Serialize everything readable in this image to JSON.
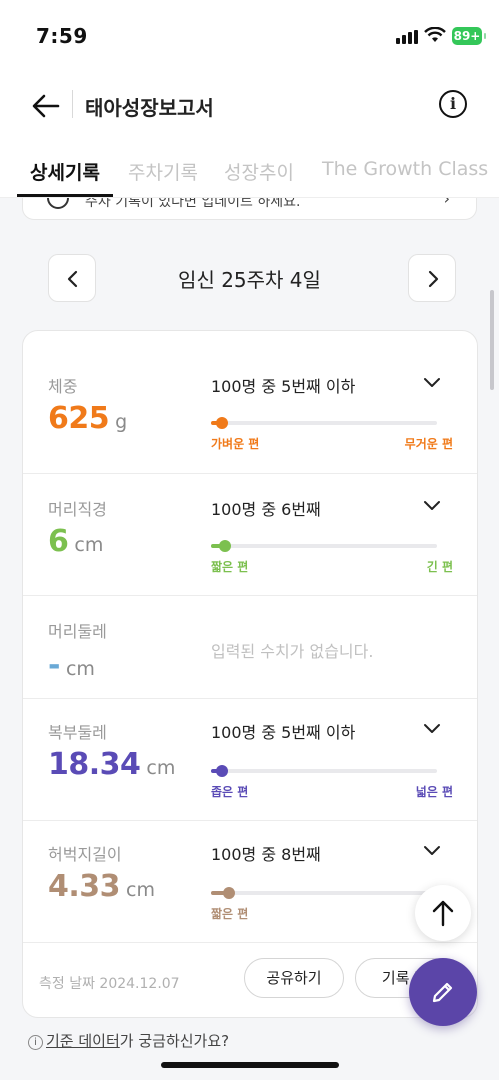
{
  "status_bar": {
    "time": "7:59",
    "battery": "89+"
  },
  "header": {
    "title": "태아성장보고서",
    "info_label": "i"
  },
  "tabs": [
    {
      "label": "상세기록",
      "active": true
    },
    {
      "label": "주차기록",
      "active": false
    },
    {
      "label": "성장추이",
      "active": false
    },
    {
      "label": "The Growth Class",
      "active": false
    }
  ],
  "notice": {
    "text": "주차 기록이 있다면 업데이트 하세요."
  },
  "week_nav": {
    "label": "임신 25주차 4일"
  },
  "measurements": [
    {
      "label": "체중",
      "value": "625",
      "unit": "g",
      "rank": "100명 중 5번째 이하",
      "low": "가벼운 편",
      "high": "무거운 편",
      "percentile": 0.05,
      "color": "#f07a1a"
    },
    {
      "label": "머리직경",
      "value": "6",
      "unit": "cm",
      "rank": "100명 중 6번째",
      "low": "짧은 편",
      "high": "긴 편",
      "percentile": 0.06,
      "color": "#7cc04f"
    },
    {
      "label": "머리둘레",
      "value": "-",
      "unit": "cm",
      "empty_text": "입력된 수치가 없습니다.",
      "color": "#6aa9d6"
    },
    {
      "label": "복부둘레",
      "value": "18.34",
      "unit": "cm",
      "rank": "100명 중 5번째 이하",
      "low": "좁은 편",
      "high": "넓은 편",
      "percentile": 0.05,
      "color": "#5a4bb6"
    },
    {
      "label": "허벅지길이",
      "value": "4.33",
      "unit": "cm",
      "rank": "100명 중 8번째",
      "low": "짧은 편",
      "high": "",
      "percentile": 0.08,
      "color": "#b08e74"
    }
  ],
  "footer": {
    "date": "측정 날짜 2024.12.07",
    "share_label": "공유하기",
    "record_label": "기록 편"
  },
  "faq": {
    "link_text": "기준 데이터",
    "rest_text": "가 궁금하신가요?"
  }
}
